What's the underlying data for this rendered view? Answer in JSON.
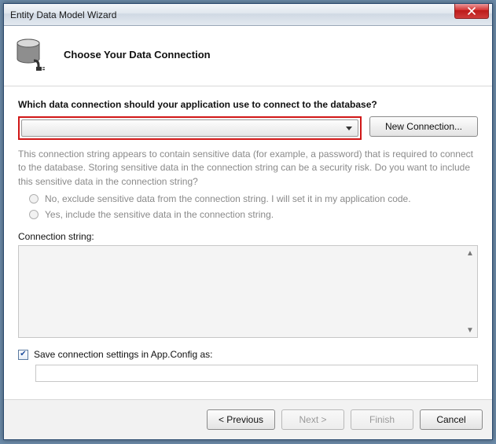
{
  "window": {
    "title": "Entity Data Model Wizard"
  },
  "header": {
    "title": "Choose Your Data Connection"
  },
  "main": {
    "question": "Which data connection should your application use to connect to the database?",
    "connection_value": "",
    "new_connection_label": "New Connection...",
    "sensitive_text": "This connection string appears to contain sensitive data (for example, a password) that is required to connect to the database. Storing sensitive data in the connection string can be a security risk. Do you want to include this sensitive data in the connection string?",
    "radio_exclude": "No, exclude sensitive data from the connection string. I will set it in my application code.",
    "radio_include": "Yes, include the sensitive data in the connection string.",
    "connection_string_label": "Connection string:",
    "connection_string_value": "",
    "save_settings_label": "Save connection settings in App.Config as:",
    "save_settings_value": ""
  },
  "footer": {
    "previous": "< Previous",
    "next": "Next >",
    "finish": "Finish",
    "cancel": "Cancel"
  }
}
